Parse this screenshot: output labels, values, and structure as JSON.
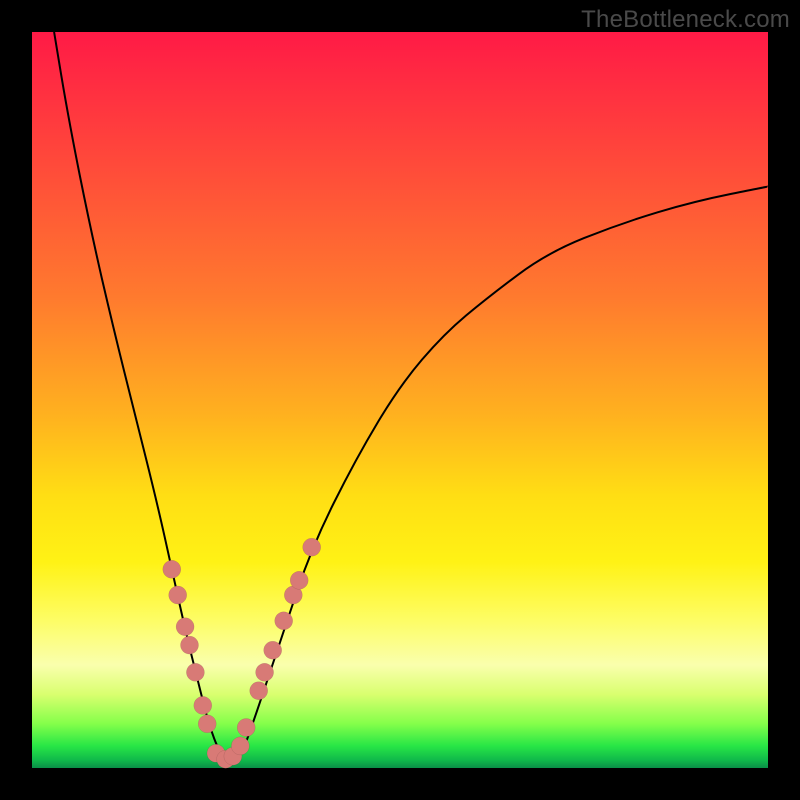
{
  "watermark": "TheBottleneck.com",
  "chart_data": {
    "type": "line",
    "title": "",
    "xlabel": "",
    "ylabel": "",
    "xlim": [
      0,
      100
    ],
    "ylim": [
      0,
      100
    ],
    "series": [
      {
        "name": "curve",
        "x": [
          3,
          5,
          8,
          11,
          14,
          17,
          19,
          21,
          22.5,
          24,
          25.5,
          27,
          28.5,
          30,
          34,
          38,
          44,
          50,
          56,
          62,
          70,
          80,
          90,
          100
        ],
        "y": [
          100,
          88,
          73,
          60,
          48,
          36,
          27,
          18,
          12,
          6,
          2,
          1,
          2,
          6,
          18,
          30,
          42,
          52,
          59,
          64,
          70,
          74,
          77,
          79
        ]
      }
    ],
    "markers": {
      "name": "highlight-points",
      "x": [
        19.0,
        19.8,
        20.8,
        21.4,
        22.2,
        23.2,
        23.8,
        25.0,
        26.3,
        27.3,
        28.3,
        29.1,
        30.8,
        31.6,
        32.7,
        34.2,
        35.5,
        36.3,
        38.0
      ],
      "y": [
        27.0,
        23.5,
        19.2,
        16.7,
        13.0,
        8.5,
        6.0,
        2.0,
        1.2,
        1.6,
        3.0,
        5.5,
        10.5,
        13.0,
        16.0,
        20.0,
        23.5,
        25.5,
        30.0
      ]
    },
    "gradient_stops": [
      {
        "pos": 0.0,
        "color": "#ff1a46"
      },
      {
        "pos": 0.18,
        "color": "#ff4a3a"
      },
      {
        "pos": 0.36,
        "color": "#ff7a2e"
      },
      {
        "pos": 0.52,
        "color": "#ffb11f"
      },
      {
        "pos": 0.63,
        "color": "#ffde14"
      },
      {
        "pos": 0.72,
        "color": "#fff215"
      },
      {
        "pos": 0.8,
        "color": "#fdfd66"
      },
      {
        "pos": 0.86,
        "color": "#faffad"
      },
      {
        "pos": 0.9,
        "color": "#d9ff6f"
      },
      {
        "pos": 0.94,
        "color": "#84ff4a"
      },
      {
        "pos": 0.97,
        "color": "#28e646"
      },
      {
        "pos": 0.99,
        "color": "#0fb74a"
      },
      {
        "pos": 1.0,
        "color": "#0a8f48"
      }
    ]
  }
}
